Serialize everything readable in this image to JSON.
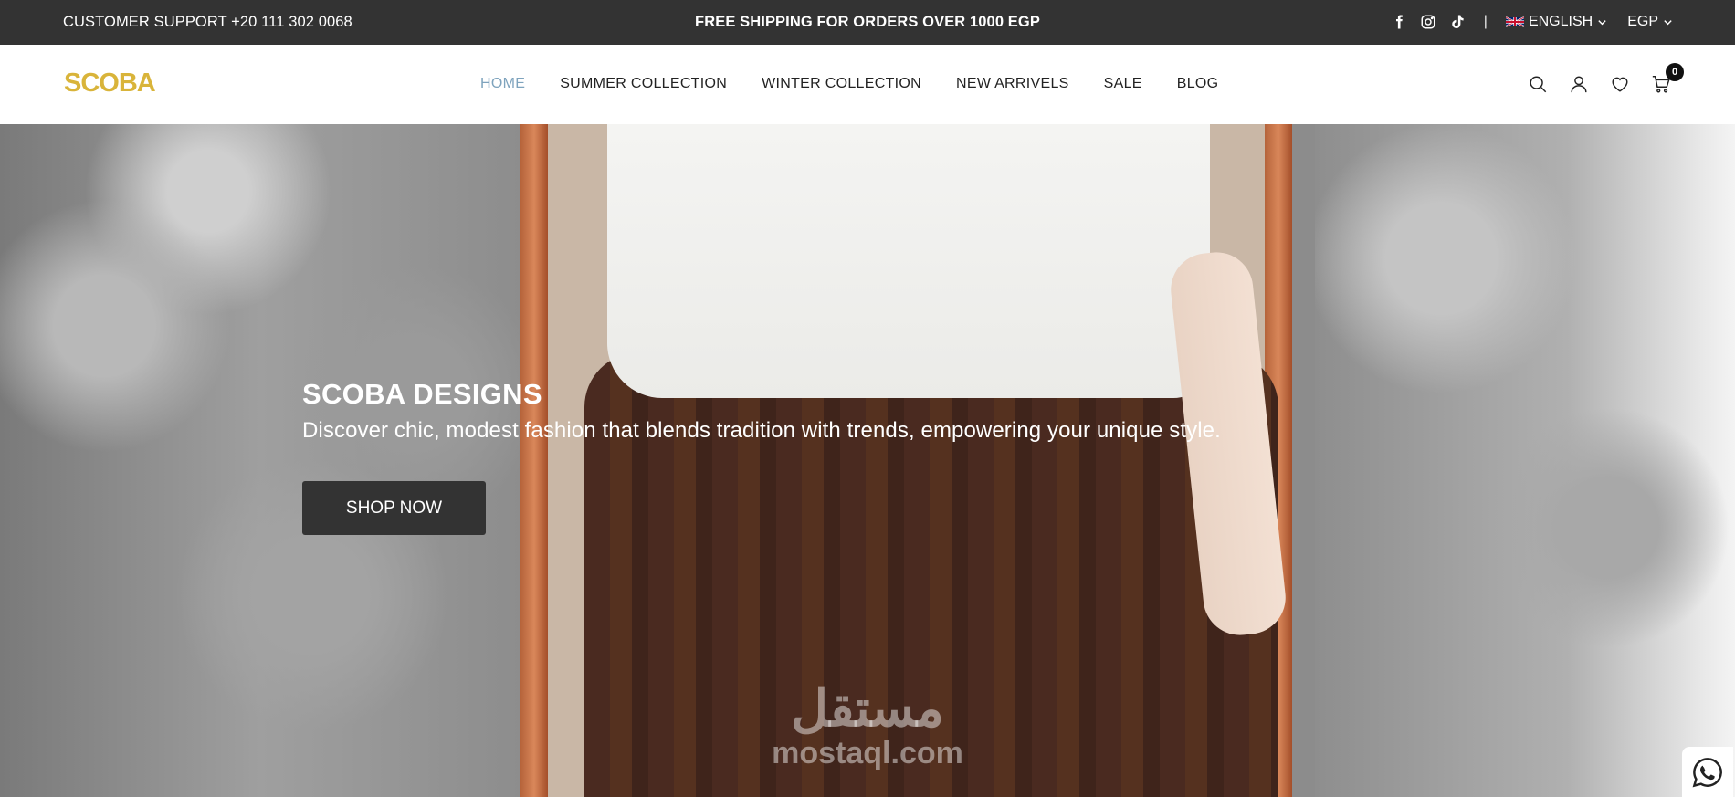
{
  "topbar": {
    "support": "CUSTOMER SUPPORT +20 111 302 0068",
    "shipping": "FREE SHIPPING FOR ORDERS OVER 1000 EGP",
    "separator": "|",
    "language": "ENGLISH",
    "currency": "EGP",
    "social_icons": [
      "facebook-icon",
      "instagram-icon",
      "tiktok-icon"
    ]
  },
  "header": {
    "logo": "SCOBA",
    "nav": [
      {
        "label": "HOME",
        "active": true
      },
      {
        "label": "SUMMER COLLECTION"
      },
      {
        "label": "WINTER COLLECTION"
      },
      {
        "label": "NEW ARRIVELS"
      },
      {
        "label": "SALE"
      },
      {
        "label": "BLOG"
      }
    ],
    "cart_count": "0",
    "active_color": "#7ea3bd",
    "logo_color": "#d9b43a"
  },
  "hero": {
    "title": "SCOBA DESIGNS",
    "subtitle": "Discover chic, modest fashion that blends tradition with trends, empowering your unique style.",
    "button": "SHOP NOW"
  },
  "watermark": {
    "arabic": "مستقل",
    "latin": "mostaql.com"
  }
}
